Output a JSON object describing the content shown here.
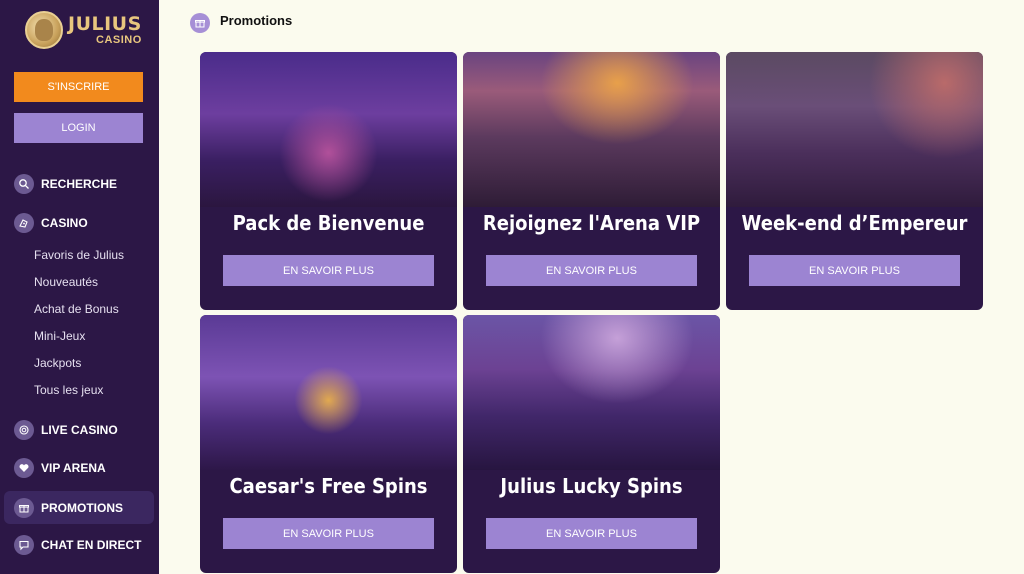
{
  "brand": {
    "name": "JULIUS",
    "sub": "CASINO"
  },
  "auth": {
    "signup_label": "S'INSCRIRE",
    "login_label": "LOGIN"
  },
  "nav": {
    "search": "RECHERCHE",
    "casino": "CASINO",
    "casino_items": [
      "Favoris de Julius",
      "Nouveautés",
      "Achat de Bonus",
      "Mini-Jeux",
      "Jackpots",
      "Tous les jeux"
    ],
    "live_casino": "LIVE CASINO",
    "vip_arena": "VIP ARENA",
    "promotions": "PROMOTIONS",
    "chat": "CHAT EN DIRECT"
  },
  "page": {
    "title": "Promotions"
  },
  "promotions": [
    {
      "title": "Pack de Bienvenue",
      "button": "EN SAVOIR PLUS"
    },
    {
      "title": "Rejoignez l'Arena VIP",
      "button": "EN SAVOIR PLUS"
    },
    {
      "title": "Week-end d’Empereur",
      "button": "EN SAVOIR PLUS"
    },
    {
      "title": "Caesar's Free Spins",
      "button": "EN SAVOIR PLUS"
    },
    {
      "title": "Julius Lucky Spins",
      "button": "EN SAVOIR PLUS"
    }
  ],
  "colors": {
    "sidebar_bg": "#2c1746",
    "accent_orange": "#f28a1d",
    "accent_purple": "#9c84d2",
    "page_bg": "#fbfbee"
  }
}
